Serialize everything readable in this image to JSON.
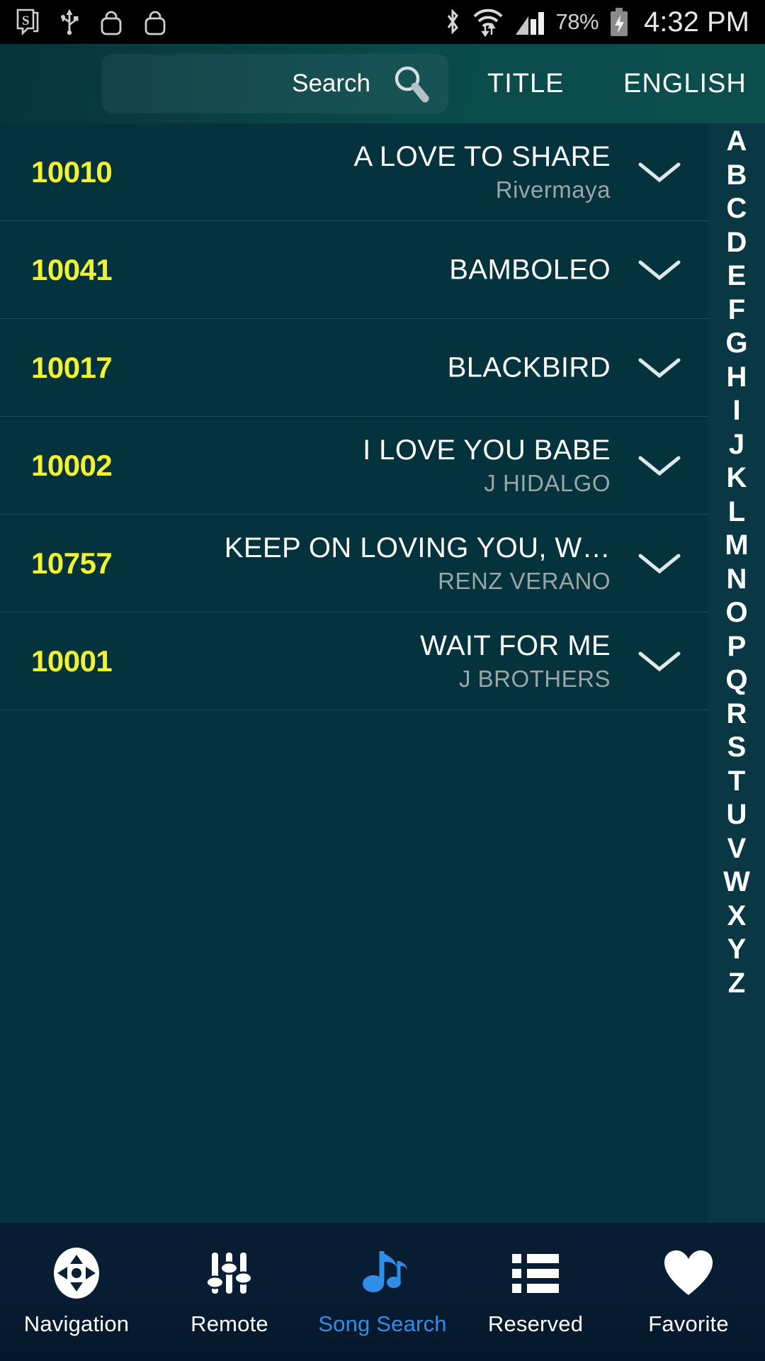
{
  "status_bar": {
    "icons_left": [
      "s-note-icon",
      "usb-icon",
      "bag-icon",
      "bag-icon"
    ],
    "icons_right": [
      "bluetooth-icon",
      "wifi-icon",
      "signal-icon"
    ],
    "battery_percent": "78%",
    "battery_icon": "battery-charging-icon",
    "clock": "4:32 PM"
  },
  "header": {
    "search_placeholder": "Search",
    "search_value": "",
    "search_icon": "magnifier-icon",
    "title_tab": "TITLE",
    "language_tab": "ENGLISH"
  },
  "songs": [
    {
      "number": "10010",
      "title": "A LOVE TO SHARE",
      "artist": "Rivermaya",
      "expand_icon": "chevron-down-icon"
    },
    {
      "number": "10041",
      "title": "BAMBOLEO",
      "artist": "",
      "expand_icon": "chevron-down-icon"
    },
    {
      "number": "10017",
      "title": "BLACKBIRD",
      "artist": "",
      "expand_icon": "chevron-down-icon"
    },
    {
      "number": "10002",
      "title": "I LOVE YOU BABE",
      "artist": "J HIDALGO",
      "expand_icon": "chevron-down-icon"
    },
    {
      "number": "10757",
      "title": "KEEP ON LOVING YOU, W…",
      "artist": "RENZ VERANO",
      "expand_icon": "chevron-down-icon"
    },
    {
      "number": "10001",
      "title": "WAIT FOR ME",
      "artist": "J BROTHERS",
      "expand_icon": "chevron-down-icon"
    }
  ],
  "alphabet_index": [
    "A",
    "B",
    "C",
    "D",
    "E",
    "F",
    "G",
    "H",
    "I",
    "J",
    "K",
    "L",
    "M",
    "N",
    "O",
    "P",
    "Q",
    "R",
    "S",
    "T",
    "U",
    "V",
    "W",
    "X",
    "Y",
    "Z"
  ],
  "bottom_nav": {
    "items": [
      {
        "label": "Navigation",
        "icon": "dpad-icon",
        "active": false
      },
      {
        "label": "Remote",
        "icon": "sliders-icon",
        "active": false
      },
      {
        "label": "Song Search",
        "icon": "music-note-icon",
        "active": true
      },
      {
        "label": "Reserved",
        "icon": "list-icon",
        "active": false
      },
      {
        "label": "Favorite",
        "icon": "heart-icon",
        "active": false
      }
    ]
  },
  "colors": {
    "accent_yellow": "#f2f231",
    "active_blue": "#2f8fe8",
    "background_teal": "#05333d",
    "header_teal": "#0a4a4b",
    "nav_navy": "#081d34"
  }
}
